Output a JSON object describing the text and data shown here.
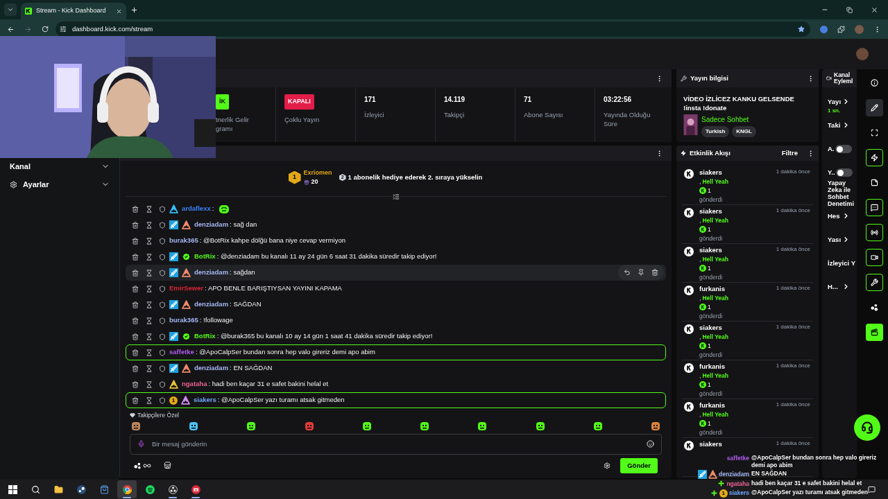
{
  "browser": {
    "tab_title": "Stream - Kick Dashboard",
    "url": "dashboard.kick.com/stream"
  },
  "sidebar": {
    "items": [
      {
        "label": "Kanal"
      },
      {
        "label": "Ayarlar"
      }
    ]
  },
  "stats": [
    {
      "kind": "badge",
      "badge": "İK",
      "color": "#53fc18",
      "lines": [
        "tnerlik Gelir",
        "gramı"
      ]
    },
    {
      "kind": "badge",
      "badge": "KAPALI",
      "color": "#e11d48",
      "lines": [
        "Çoklu Yayın"
      ]
    },
    {
      "kind": "value",
      "value": "171",
      "lines": [
        "İzleyici"
      ]
    },
    {
      "kind": "value",
      "value": "14.119",
      "lines": [
        "Takipçi"
      ]
    },
    {
      "kind": "value",
      "value": "71",
      "lines": [
        "Abone Sayısı"
      ]
    },
    {
      "kind": "value",
      "value": "03:22:56",
      "lines": [
        "Yayında Olduğu",
        "Süre"
      ]
    }
  ],
  "leaderboard": {
    "rank": "1",
    "name": "Exriomen",
    "count": "20",
    "next_rank": "2",
    "hint": "1 abonelik hediye ederek 2. sıraya yükselin"
  },
  "chat": {
    "messages": [
      {
        "kind": "emote",
        "user": "ardaflexx",
        "color": "#3b82f6",
        "text": ":",
        "badges": [
          {
            "kind": "og",
            "color": "#38bdf8"
          }
        ],
        "highlighted": false,
        "hovered": false
      },
      {
        "kind": "text",
        "user": "denziadam",
        "color": "#a5b8f5",
        "text": ": sağ dan",
        "badges": [
          {
            "kind": "mod"
          },
          {
            "kind": "og",
            "color": "#f08a6c"
          }
        ],
        "highlighted": false,
        "hovered": false
      },
      {
        "kind": "text",
        "user": "burak365",
        "color": "#a5b8f5",
        "text": ": @BotRix kahpe dölğü bana niye cevap vermiyon",
        "highlighted": false,
        "hovered": false
      },
      {
        "kind": "text",
        "user": "BotRix",
        "color": "#53fc18",
        "text": ": @denziadam bu kanalı 11 ay 24 gün 6 saat 31 dakika süredir takip ediyor!",
        "badges": [
          {
            "kind": "mod"
          },
          {
            "kind": "verified"
          }
        ],
        "highlighted": false,
        "hovered": false
      },
      {
        "kind": "text",
        "user": "denziadam",
        "color": "#a5b8f5",
        "text": ": sağdan",
        "badges": [
          {
            "kind": "mod"
          },
          {
            "kind": "og",
            "color": "#f08a6c"
          }
        ],
        "highlighted": false,
        "hovered": true
      },
      {
        "kind": "text",
        "user": "EmirSewer",
        "color": "#dc2638",
        "text": ": APO BENLE BARIŞTIYSAN YAYINI KAPAMA",
        "highlighted": false,
        "hovered": false
      },
      {
        "kind": "text",
        "user": "denziadam",
        "color": "#a5b8f5",
        "text": ": SAĞDAN",
        "badges": [
          {
            "kind": "mod"
          },
          {
            "kind": "og",
            "color": "#f08a6c"
          }
        ],
        "highlighted": false,
        "hovered": false
      },
      {
        "kind": "text",
        "user": "burak365",
        "color": "#a5b8f5",
        "text": ": !followage",
        "highlighted": false,
        "hovered": false
      },
      {
        "kind": "text",
        "user": "BotRix",
        "color": "#53fc18",
        "text": ": @burak365 bu kanalı 10 ay 14 gün 1 saat 41 dakika süredir takip ediyor!",
        "badges": [
          {
            "kind": "mod"
          },
          {
            "kind": "verified"
          }
        ],
        "highlighted": false,
        "hovered": false
      },
      {
        "kind": "text",
        "user": "saffetke",
        "color": "#b05cf0",
        "text": ": @ApoCalpSer bundan sonra hep valo gireriz demi apo abim",
        "highlighted": true,
        "hovered": false
      },
      {
        "kind": "text",
        "user": "denziadam",
        "color": "#a5b8f5",
        "text": ": EN SAĞDAN",
        "badges": [
          {
            "kind": "mod"
          },
          {
            "kind": "og",
            "color": "#f08a6c"
          }
        ],
        "highlighted": false,
        "hovered": false
      },
      {
        "kind": "text",
        "user": "ngataha",
        "color": "#f06292",
        "text": ": hadi ben kaçar 31 e safet bakini helal et",
        "badges": [
          {
            "kind": "og",
            "color": "#e8c33a"
          }
        ],
        "highlighted": false,
        "hovered": false
      },
      {
        "kind": "text",
        "user": "siakers",
        "color": "#6ea8ff",
        "text": ": @ApoCalpSer yazı turamı atsak gitmeden",
        "badges": [
          {
            "kind": "gift",
            "text": "1"
          },
          {
            "kind": "og",
            "color": "#d08cf0"
          }
        ],
        "highlighted": true,
        "hovered": false
      }
    ],
    "emote_section": "Takipçilere Özel",
    "emotes": [
      {
        "color": "#c0855a"
      },
      {
        "color": "#4cc3f0"
      },
      {
        "color": "#53fc18"
      },
      {
        "color": "#e23b3b"
      },
      {
        "color": "#53fc18"
      },
      {
        "color": "#53fc18"
      },
      {
        "color": "#53fc18"
      },
      {
        "color": "#53fc18"
      },
      {
        "color": "#53fc18"
      },
      {
        "color": "#d9833a"
      }
    ],
    "placeholder": "Bir mesaj gönderin",
    "send": "Gönder"
  },
  "stream_info": {
    "header": "Yayın bilgisi",
    "title": "VİDEO İZLİCEZ KANKU GELSENDE !insta !donate",
    "category": "Sadece Sohbet",
    "tags": [
      "Turkish",
      "KNGL"
    ]
  },
  "events": {
    "header": "Etkinlik Akışı",
    "filter": "Filtre",
    "items": [
      {
        "user": "siakers",
        "prefix": ",",
        "reward": "Hell Yeah",
        "amount": "1",
        "verb": "gönderdi",
        "time": "1 dakika önce"
      },
      {
        "user": "siakers",
        "prefix": ",",
        "reward": "Hell Yeah",
        "amount": "1",
        "verb": "gönderdi",
        "time": "1 dakika önce"
      },
      {
        "user": "siakers",
        "prefix": ",",
        "reward": "Hell Yeah",
        "amount": "1",
        "verb": "gönderdi",
        "time": "1 dakika önce"
      },
      {
        "user": "furkanis",
        "prefix": ",",
        "reward": "Hell Yeah",
        "amount": "1",
        "verb": "gönderdi",
        "time": "1 dakika önce"
      },
      {
        "user": "siakers",
        "prefix": ",",
        "reward": "Hell Yeah",
        "amount": "1",
        "verb": "gönderdi",
        "time": "1 dakika önce"
      },
      {
        "user": "furkanis",
        "prefix": ",",
        "reward": "Hell Yeah",
        "amount": "1",
        "verb": "gönderdi",
        "time": "1 dakika önce"
      },
      {
        "user": "furkanis",
        "prefix": ",",
        "reward": "Hell Yeah",
        "amount": "1",
        "verb": "gönderdi",
        "time": "1 dakika önce"
      },
      {
        "user": "siakers",
        "time": "1 dakika önce"
      }
    ]
  },
  "channel_actions": {
    "title": "Kanal Eyleml",
    "items": [
      {
        "kind": "link",
        "label": "Yayı",
        "sub": "1 sn."
      },
      {
        "kind": "link",
        "label": "Taki"
      },
      {
        "kind": "toggle",
        "label": "A.",
        "on": false
      },
      {
        "kind": "toggle",
        "label": "Y..",
        "on": false,
        "sub": "Yapay Zeka ile Sohbet Denetimi"
      },
      {
        "kind": "link",
        "label": "Hes"
      },
      {
        "kind": "link",
        "label": "Yası"
      },
      {
        "kind": "text",
        "label": "İzleyici Y"
      },
      {
        "kind": "link",
        "label": "H..."
      }
    ]
  },
  "rail": [
    {
      "kind": "plain"
    },
    {
      "kind": "selected"
    },
    {
      "kind": "plain"
    },
    {
      "kind": "outlined"
    },
    {
      "kind": "plain"
    },
    {
      "kind": "outlined"
    },
    {
      "kind": "outlined"
    },
    {
      "kind": "outlined"
    },
    {
      "kind": "outlined"
    },
    {
      "kind": "plain"
    },
    {
      "kind": "filled"
    }
  ],
  "overlay_chat": [
    {
      "user": "saffetke",
      "color": "#b05cf0",
      "text": "@ApoCalpSer bundan sonra hep valo gireriz demi apo abim"
    },
    {
      "user": "denziadam",
      "color": "#a5b8f5",
      "text": "EN SAĞDAN",
      "badges": [
        {
          "kind": "mod"
        },
        {
          "kind": "og",
          "color": "#f08a6c"
        }
      ]
    },
    {
      "user": "ngataha",
      "color": "#f06292",
      "text": "hadi ben kaçar 31 e safet bakini helal et",
      "badges": [
        {
          "kind": "plus"
        }
      ]
    },
    {
      "user": "siakers",
      "color": "#6ea8ff",
      "text": "@ApoCalpSer yazı turamı atsak gitmeden",
      "badges": [
        {
          "kind": "plus"
        },
        {
          "kind": "gift",
          "text": "1"
        }
      ]
    }
  ],
  "taskbar": [
    {
      "selected": false,
      "running": false
    },
    {
      "selected": false,
      "running": false
    },
    {
      "selected": false,
      "running": false
    },
    {
      "selected": false,
      "running": false
    },
    {
      "selected": false,
      "running": false
    },
    {
      "selected": true,
      "running": true
    },
    {
      "selected": false,
      "running": false
    },
    {
      "selected": false,
      "running": true
    },
    {
      "selected": false,
      "running": true
    }
  ]
}
